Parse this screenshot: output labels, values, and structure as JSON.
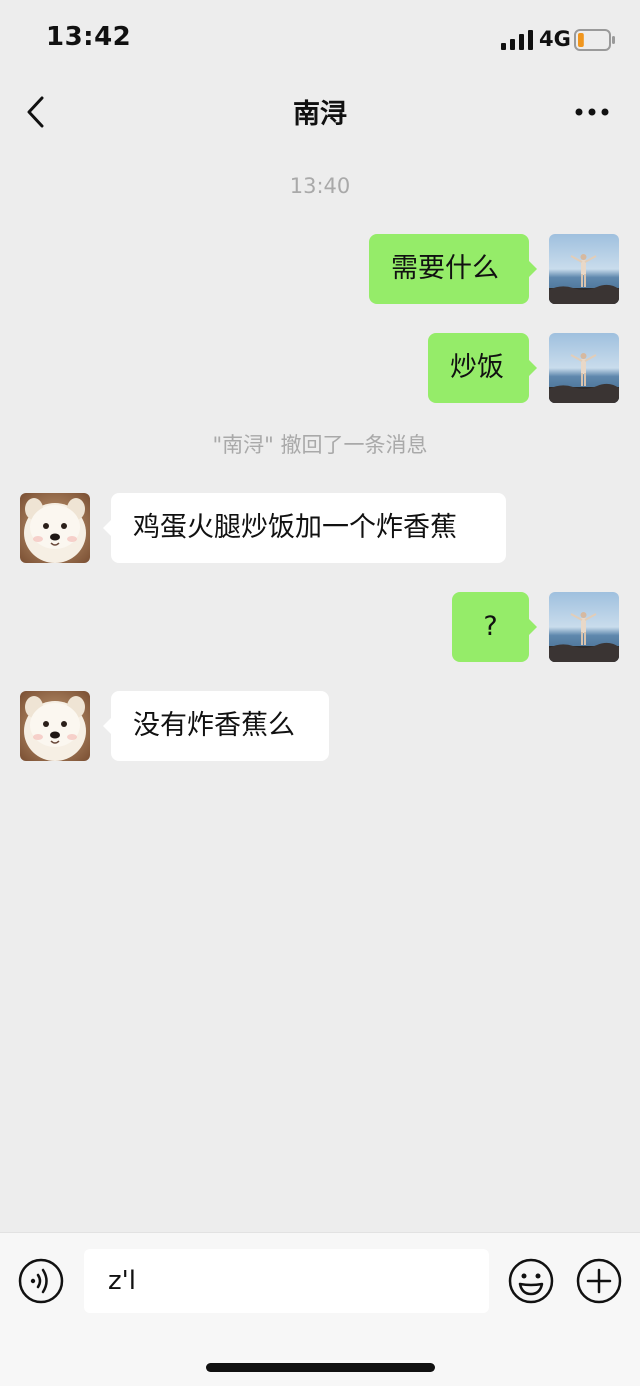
{
  "status_bar": {
    "time": "13:42",
    "network": "4G",
    "battery_level": 0.2,
    "battery_color": "#f0961e"
  },
  "nav": {
    "back_icon": "chevron-left-icon",
    "title": "南浔",
    "more_icon": "more-dots-icon"
  },
  "chat": {
    "timestamp": "13:40",
    "recall_notice": "\"南浔\" 撤回了一条消息",
    "messages": [
      {
        "direction": "out",
        "text": "需要什么"
      },
      {
        "direction": "out",
        "text": "炒饭"
      },
      {
        "direction": "in",
        "text": "鸡蛋火腿炒饭加一个炸香蕉"
      },
      {
        "direction": "out",
        "text": "?"
      },
      {
        "direction": "in",
        "text": "没有炸香蕉么"
      }
    ],
    "colors": {
      "outgoing_bubble": "#95ec69",
      "incoming_bubble": "#ffffff",
      "background": "#ededed"
    }
  },
  "input_bar": {
    "voice_icon": "voice-icon",
    "draft_text": "z'l",
    "emoji_icon": "emoji-icon",
    "add_icon": "plus-circle-icon"
  }
}
